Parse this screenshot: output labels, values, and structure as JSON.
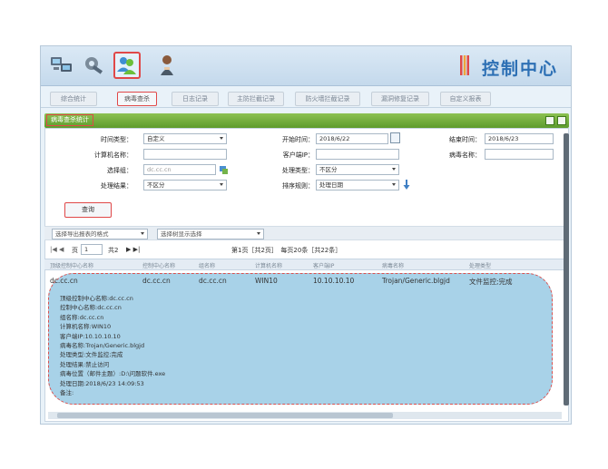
{
  "header": {
    "brand": "控制中心",
    "tools": [
      {
        "icon": "network-computers-icon"
      },
      {
        "icon": "tools-icon"
      },
      {
        "icon": "users-icon",
        "selected": true
      },
      {
        "icon": "user-icon"
      }
    ]
  },
  "tabs": [
    {
      "label": "综合统计",
      "selected": false
    },
    {
      "label": "病毒查杀",
      "selected": true
    },
    {
      "label": "日志记录",
      "selected": false
    },
    {
      "label": "主防拦截记录",
      "selected": false
    },
    {
      "label": "防火墙拦截记录",
      "selected": false
    },
    {
      "label": "漏洞修复记录",
      "selected": false
    },
    {
      "label": "自定义报表",
      "selected": false
    }
  ],
  "panel": {
    "title": "病毒查杀统计"
  },
  "form": {
    "time_type_label": "时间类型：",
    "time_type_value": "自定义",
    "start_time_label": "开始时间：",
    "start_time_value": "2018/6/22",
    "end_time_label": "结束时间：",
    "end_time_value": "2018/6/23",
    "computer_name_label": "计算机名称：",
    "computer_name_value": "",
    "client_ip_label": "客户端IP：",
    "client_ip_value": "",
    "virus_name_label": "病毒名称：",
    "virus_name_value": "",
    "group_label": "选择组：",
    "group_value": "dc.cc.cn",
    "handle_type_label": "处理类型：",
    "handle_type_value": "不区分",
    "handle_result_label": "处理结果：",
    "handle_result_value": "不区分",
    "sort_label": "排序规则：",
    "sort_value": "处理日期",
    "query_button": "查询"
  },
  "export": {
    "format_select": "选择导出报表的格式",
    "display_select": "选择树显示选择"
  },
  "pager": {
    "prev_controls": "|◀ ◀",
    "page_label": "页",
    "page_input": "1",
    "total_pages": "共2",
    "next_controls": "▶ ▶|",
    "summary": "第1页［共2页］　每页20条［共22条］"
  },
  "table": {
    "headers": [
      "顶级控制中心名称",
      "控制中心名称",
      "组名称",
      "计算机名称",
      "客户端IP",
      "病毒名称",
      "处理类型"
    ],
    "row": [
      "dc.cc.cn",
      "dc.cc.cn",
      "dc.cc.cn",
      "WIN10",
      "10.10.10.10",
      "Trojan/Generic.blgjd",
      "文件监控;完成"
    ]
  },
  "detail": {
    "lines": [
      "顶级控制中心名称:dc.cc.cn",
      "控制中心名称:dc.cc.cn",
      "组名称:dc.cc.cn",
      "计算机名称:WIN10",
      "客户端IP:10.10.10.10",
      "病毒名称:Trojan/Generic.blgjd",
      "处理类型:文件监控;完成",
      "处理结果:禁止访问",
      "病毒位置（邮件主题）:D:\\问题软件.exe",
      "处理日期:2018/6/23 14:09:53",
      "备注:"
    ]
  },
  "colors": {
    "accent": "#2c6fb4",
    "highlight": "#e04848",
    "panel_head": "#6aa83a",
    "detail_bg": "#a8d2e8"
  }
}
